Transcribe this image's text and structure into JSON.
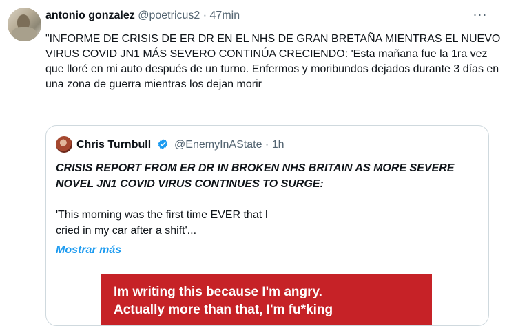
{
  "tweet": {
    "author_name": "antonio gonzalez",
    "handle": "@poetricus2",
    "separator": "·",
    "time": "47min",
    "more_glyph": "···",
    "text": "\"INFORME DE CRISIS DE ER DR EN EL NHS DE GRAN BRETAÑA MIENTRAS EL NUEVO VIRUS COVID JN1 MÁS SEVERO CONTINÚA CRECIENDO: 'Esta mañana fue la 1ra vez que lloré en mi auto después de un turno. Enfermos y moribundos dejados durante 3 días en una zona de guerra mientras los dejan morir"
  },
  "quote": {
    "author_name": "Chris Turnbull",
    "handle": "@EnemyInAState",
    "separator": "·",
    "time": "1h",
    "title": "CRISIS REPORT FROM ER DR IN BROKEN NHS BRITAIN AS MORE SEVERE NOVEL JN1 COVID VIRUS CONTINUES TO SURGE:",
    "body": "'This morning was the first time EVER that I\ncried in my car after a shift'...",
    "show_more": "Mostrar más",
    "image_text": "Im writing this because I'm angry.\nActually more than that, I'm fu*king"
  },
  "colors": {
    "accent": "#1d9bf0",
    "secondary_text": "#536471",
    "image_background": "#c62227"
  }
}
